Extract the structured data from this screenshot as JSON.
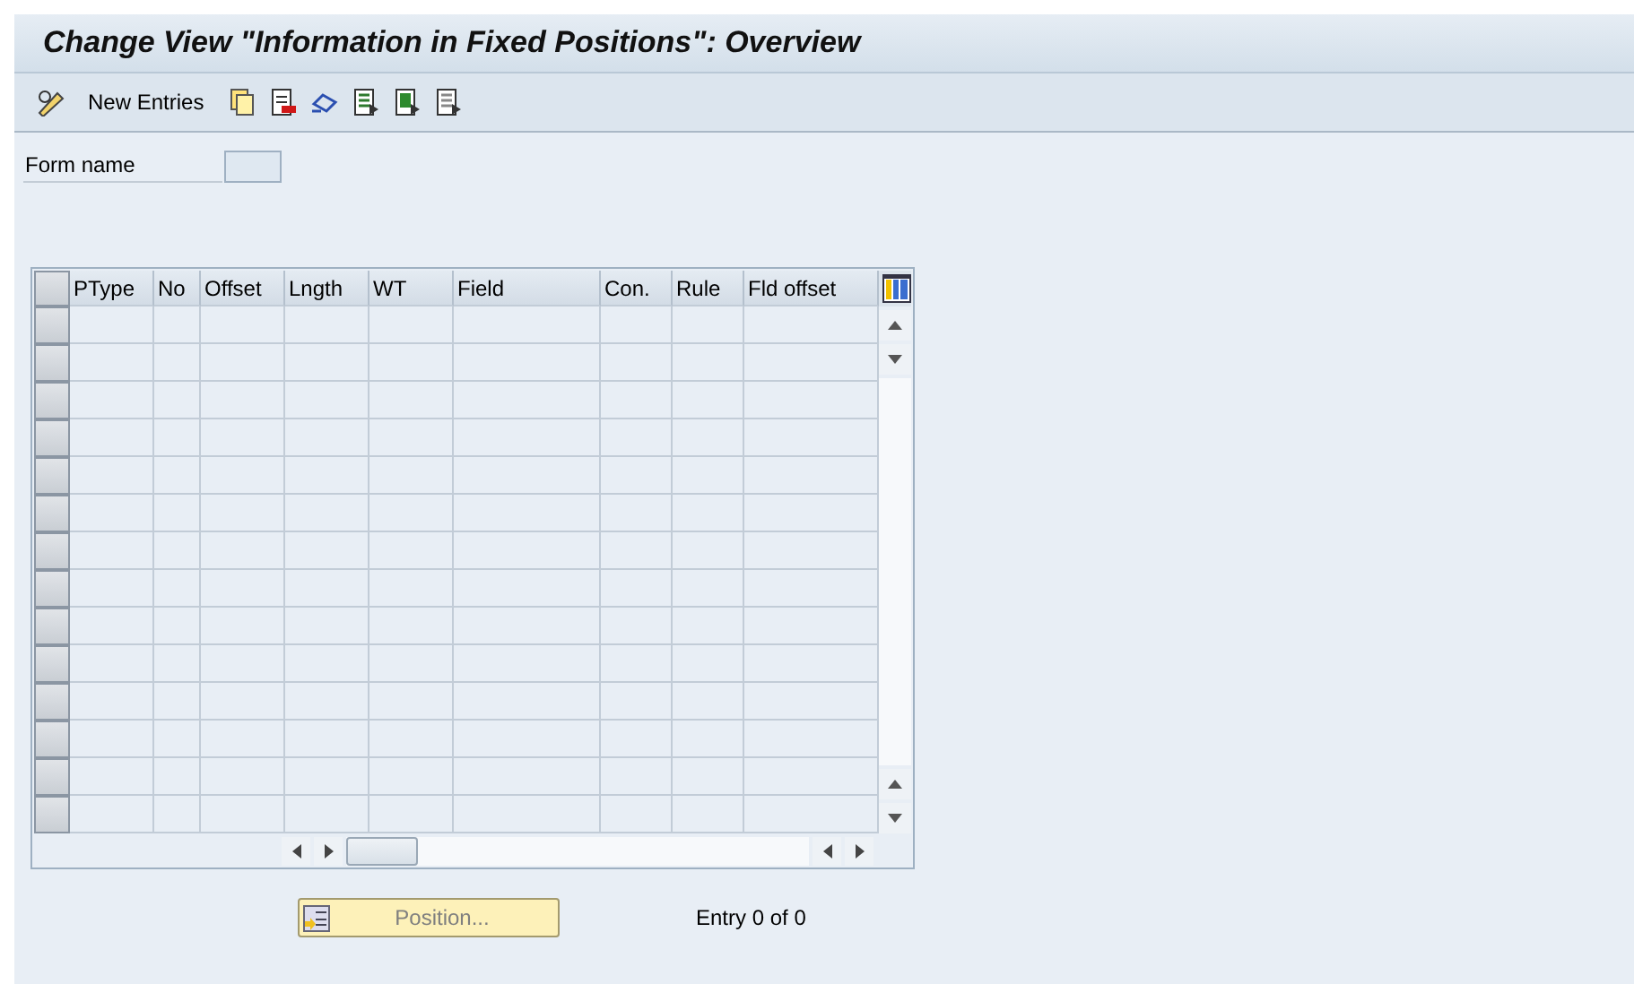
{
  "window": {
    "title": "Change View \"Information in Fixed Positions\": Overview"
  },
  "toolbar": {
    "new_entries": "New Entries"
  },
  "form": {
    "label": "Form name"
  },
  "table": {
    "columns": [
      "PType",
      "No",
      "Offset",
      "Lngth",
      "WT",
      "Field",
      "Con.",
      "Rule",
      "Fld offset"
    ]
  },
  "position_button": {
    "label": "Position...",
    "disabled": true
  },
  "entry_info": "Entry 0 of 0"
}
